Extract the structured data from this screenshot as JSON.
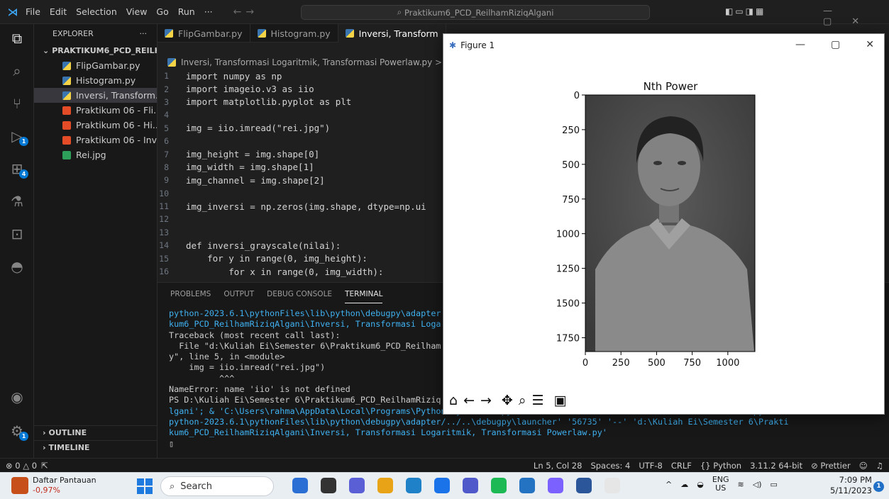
{
  "window": {
    "menu": [
      "File",
      "Edit",
      "Selection",
      "View",
      "Go",
      "Run",
      "···"
    ],
    "search_text": "Praktikum6_PCD_ReilhamRiziqAlgani"
  },
  "activity_bar": {
    "icons": [
      "explorer-icon",
      "search-icon",
      "source-control-icon",
      "run-debug-icon",
      "extensions-icon",
      "testing-icon",
      "remote-explorer-icon",
      "android-icon",
      "account-icon",
      "settings-gear-icon"
    ],
    "run_badge": "1",
    "extensions_badge": "4",
    "settings_badge": "1"
  },
  "sidebar": {
    "title": "EXPLORER",
    "more": "···",
    "folder": "PRAKTIKUM6_PCD_REILHA...",
    "files": [
      {
        "name": "FlipGambar.py",
        "type": "py"
      },
      {
        "name": "Histogram.py",
        "type": "py"
      },
      {
        "name": "Inversi, Transform...",
        "type": "py"
      },
      {
        "name": "Praktikum 06 - Fli...",
        "type": "html"
      },
      {
        "name": "Praktikum 06 - Hi...",
        "type": "html"
      },
      {
        "name": "Praktikum 06 - Inv...",
        "type": "html"
      },
      {
        "name": "Rei.jpg",
        "type": "img"
      }
    ],
    "outline": "OUTLINE",
    "timeline": "TIMELINE"
  },
  "tabs": [
    "FlipGambar.py",
    "Histogram.py",
    "Inversi, Transform"
  ],
  "breadcrumb": "Inversi, Transformasi Logaritmik, Transformasi Powerlaw.py > ...",
  "editor": {
    "lines": [
      {
        "n": "1",
        "code": "import numpy as np"
      },
      {
        "n": "2",
        "code": "import imageio.v3 as iio"
      },
      {
        "n": "3",
        "code": "import matplotlib.pyplot as plt"
      },
      {
        "n": "4",
        "code": ""
      },
      {
        "n": "5",
        "code": "img = iio.imread(\"rei.jpg\")"
      },
      {
        "n": "6",
        "code": ""
      },
      {
        "n": "7",
        "code": "img_height = img.shape[0]"
      },
      {
        "n": "8",
        "code": "img_width = img.shape[1]"
      },
      {
        "n": "9",
        "code": "img_channel = img.shape[2]"
      },
      {
        "n": "10",
        "code": ""
      },
      {
        "n": "11",
        "code": "img_inversi = np.zeros(img.shape, dtype=np.ui"
      },
      {
        "n": "12",
        "code": ""
      },
      {
        "n": "13",
        "code": ""
      },
      {
        "n": "14",
        "code": "def inversi_grayscale(nilai):"
      },
      {
        "n": "15",
        "code": "    for y in range(0, img_height):"
      },
      {
        "n": "16",
        "code": "        for x in range(0, img_width):"
      }
    ]
  },
  "panel": {
    "tabs": [
      "PROBLEMS",
      "OUTPUT",
      "DEBUG CONSOLE",
      "TERMINAL"
    ],
    "terminal": [
      {
        "text": "python-2023.6.1\\pythonFiles\\lib\\python\\debugpy\\adapter",
        "style": "path"
      },
      {
        "text": "kum6_PCD_ReilhamRiziqAlgani\\Inversi, Transformasi Loga",
        "style": "path"
      },
      {
        "text": "Traceback (most recent call last):",
        "style": "plain"
      },
      {
        "text": "  File \"d:\\Kuliah Ei\\Semester 6\\Praktikum6_PCD_Reilham",
        "style": "plain"
      },
      {
        "text": "y\", line 5, in <module>",
        "style": "plain"
      },
      {
        "text": "    img = iio.imread(\"rei.jpg\")",
        "style": "plain"
      },
      {
        "text": "          ^^^",
        "style": "plain"
      },
      {
        "text": "NameError: name 'iio' is not defined",
        "style": "plain"
      },
      {
        "text": "PS D:\\Kuliah Ei\\Semester 6\\Praktikum6_PCD_ReilhamRiziq",
        "style": "plain"
      },
      {
        "text": "lgani'; & 'C:\\Users\\rahma\\AppData\\Local\\Programs\\Python\\Python311\\python.exe' 'c:\\Users\\rahma\\.vscode\\extensions\\ms-python.",
        "style": "path"
      },
      {
        "text": "python-2023.6.1\\pythonFiles\\lib\\python\\debugpy\\adapter/../..\\debugpy\\launcher' '56735' '--' 'd:\\Kuliah Ei\\Semester 6\\Prakti",
        "style": "path"
      },
      {
        "text": "kum6_PCD_ReilhamRiziqAlgani\\Inversi, Transformasi Logaritmik, Transformasi Powerlaw.py'",
        "style": "path"
      },
      {
        "text": "▯",
        "style": "plain"
      }
    ]
  },
  "status": {
    "errors": "⊗ 0 △ 0",
    "position": "Ln 5, Col 28",
    "spaces": "Spaces: 4",
    "encoding": "UTF-8",
    "eol": "CRLF",
    "language": "{} Python",
    "interpreter": "3.11.2 64-bit",
    "prettier": "⊘ Prettier"
  },
  "figure": {
    "title": "Figure 1",
    "toolbar_icons": [
      "home-icon",
      "back-icon",
      "forward-icon",
      "pan-icon",
      "zoom-icon",
      "configure-icon",
      "save-icon"
    ]
  },
  "chart_data": {
    "type": "image",
    "title": "Nth Power",
    "x_ticks": [
      "0",
      "250",
      "500",
      "750",
      "1000"
    ],
    "y_ticks": [
      "0",
      "250",
      "500",
      "750",
      "1000",
      "1250",
      "1500",
      "1750"
    ],
    "xlim": [
      0,
      1190
    ],
    "ylim": [
      1850,
      0
    ],
    "colormap": "gray"
  },
  "taskbar": {
    "weather_title": "Daftar Pantauan",
    "weather_value": "-0,97%",
    "search": "Search",
    "lang": "ENG",
    "region": "US",
    "time": "7:09 PM",
    "date": "5/11/2023",
    "notifications": "1",
    "app_colors": [
      "#2b6fd4",
      "#333333",
      "#5a5fd6",
      "#e8a317",
      "#1f82c8",
      "#1a73e8",
      "#5059c9",
      "#1db954",
      "#2473c2",
      "#7b61ff",
      "#2b579a",
      "#e6e6e6"
    ]
  }
}
